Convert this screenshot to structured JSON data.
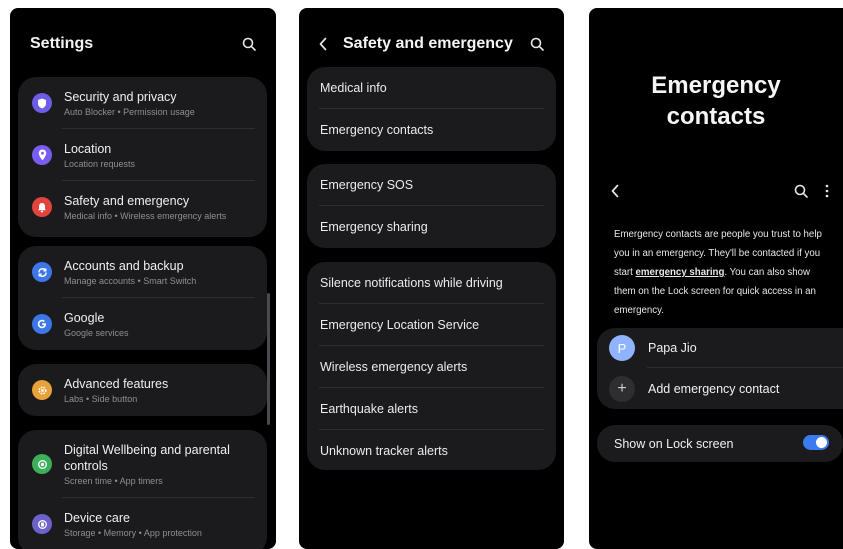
{
  "settings": {
    "title": "Settings",
    "groups": [
      [
        {
          "title": "Security and privacy",
          "subtitle": "Auto Blocker  •  Permission usage",
          "icon": "shield-icon",
          "color": "#6c5ce7"
        },
        {
          "title": "Location",
          "subtitle": "Location requests",
          "icon": "location-pin-icon",
          "color": "#7b5cf0"
        },
        {
          "title": "Safety and emergency",
          "subtitle": "Medical info  •  Wireless emergency alerts",
          "icon": "alert-bell-icon",
          "color": "#e0443d"
        }
      ],
      [
        {
          "title": "Accounts and backup",
          "subtitle": "Manage accounts  •  Smart Switch",
          "icon": "sync-icon",
          "color": "#3c76e8"
        },
        {
          "title": "Google",
          "subtitle": "Google services",
          "icon": "google-g-icon",
          "color": "#3c76e8"
        }
      ],
      [
        {
          "title": "Advanced features",
          "subtitle": "Labs  •  Side button",
          "icon": "gear-icon",
          "color": "#e8a23a"
        }
      ],
      [
        {
          "title": "Digital Wellbeing and parental controls",
          "subtitle": "Screen time  •  App timers",
          "icon": "wellbeing-icon",
          "color": "#3eae5a"
        },
        {
          "title": "Device care",
          "subtitle": "Storage  •  Memory  •  App protection",
          "icon": "device-care-icon",
          "color": "#6d62c9"
        }
      ]
    ]
  },
  "safety": {
    "title": "Safety and emergency",
    "groups": [
      [
        "Medical info",
        "Emergency contacts"
      ],
      [
        "Emergency SOS",
        "Emergency sharing"
      ],
      [
        "Silence notifications while driving",
        "Emergency Location Service",
        "Wireless emergency alerts",
        "Earthquake alerts",
        "Unknown tracker alerts"
      ]
    ]
  },
  "contacts": {
    "title_line1": "Emergency",
    "title_line2": "contacts",
    "description_before": "Emergency contacts are people you trust to help you in an emergency. They'll be contacted if you start ",
    "description_link": "emergency sharing",
    "description_after": ". You can also show them on the Lock screen for quick access in an emergency.",
    "contact_initial": "P",
    "contact_name": "Papa Jio",
    "add_label": "Add emergency contact",
    "add_symbol": "+",
    "lock_screen_label": "Show on Lock screen",
    "lock_screen_enabled": true
  }
}
